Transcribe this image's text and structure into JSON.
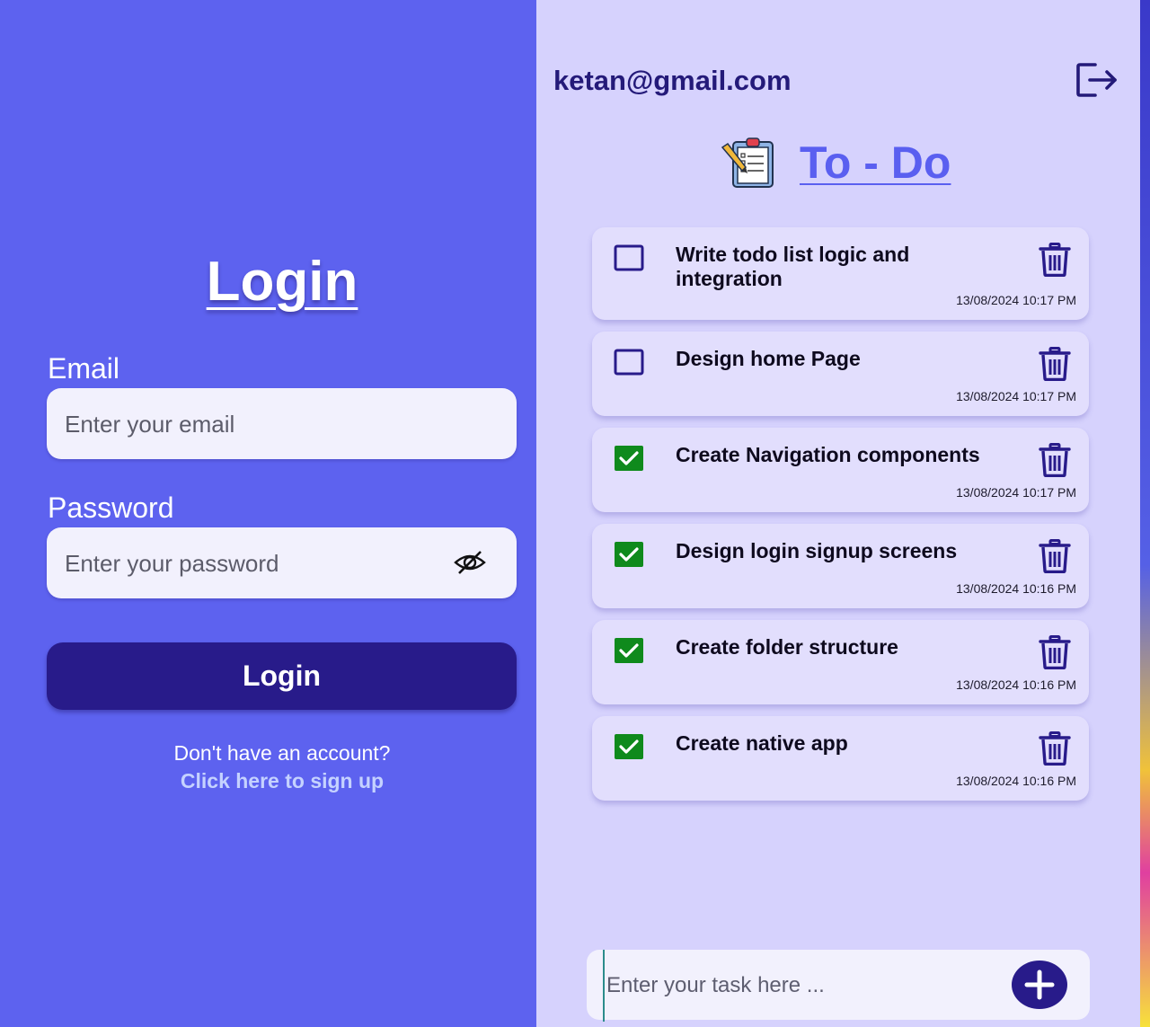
{
  "login": {
    "title": "Login",
    "email_label": "Email",
    "email_placeholder": "Enter your email",
    "password_label": "Password",
    "password_placeholder": "Enter your password",
    "password_visibility_icon": "eye-slash-icon",
    "button_label": "Login",
    "signup_prompt": "Don't have an account?",
    "signup_link": "Click here to sign up"
  },
  "todo": {
    "user_email": "ketan@gmail.com",
    "logout_icon": "logout-icon",
    "header_icon": "clipboard-icon",
    "title": "To - Do",
    "tasks": [
      {
        "text": "Write todo list logic and integration",
        "date": "13/08/2024 10:17 PM",
        "done": false
      },
      {
        "text": "Design home Page",
        "date": "13/08/2024 10:17 PM",
        "done": false
      },
      {
        "text": "Create Navigation components",
        "date": "13/08/2024 10:17 PM",
        "done": true
      },
      {
        "text": "Design login signup screens",
        "date": "13/08/2024 10:16 PM",
        "done": true
      },
      {
        "text": "Create folder structure",
        "date": "13/08/2024 10:16 PM",
        "done": true
      },
      {
        "text": "Create native app",
        "date": "13/08/2024 10:16 PM",
        "done": true
      }
    ],
    "task_placeholder": "Enter your task here ...",
    "add_icon": "plus-icon"
  },
  "colors": {
    "login_bg": "#5d62ef",
    "todo_bg": "#d6d2fd",
    "primary_dark": "#281b8a",
    "checked_green": "#0f8a1c",
    "title_blue": "#5a5ff0",
    "link": "#c5d2ff"
  }
}
